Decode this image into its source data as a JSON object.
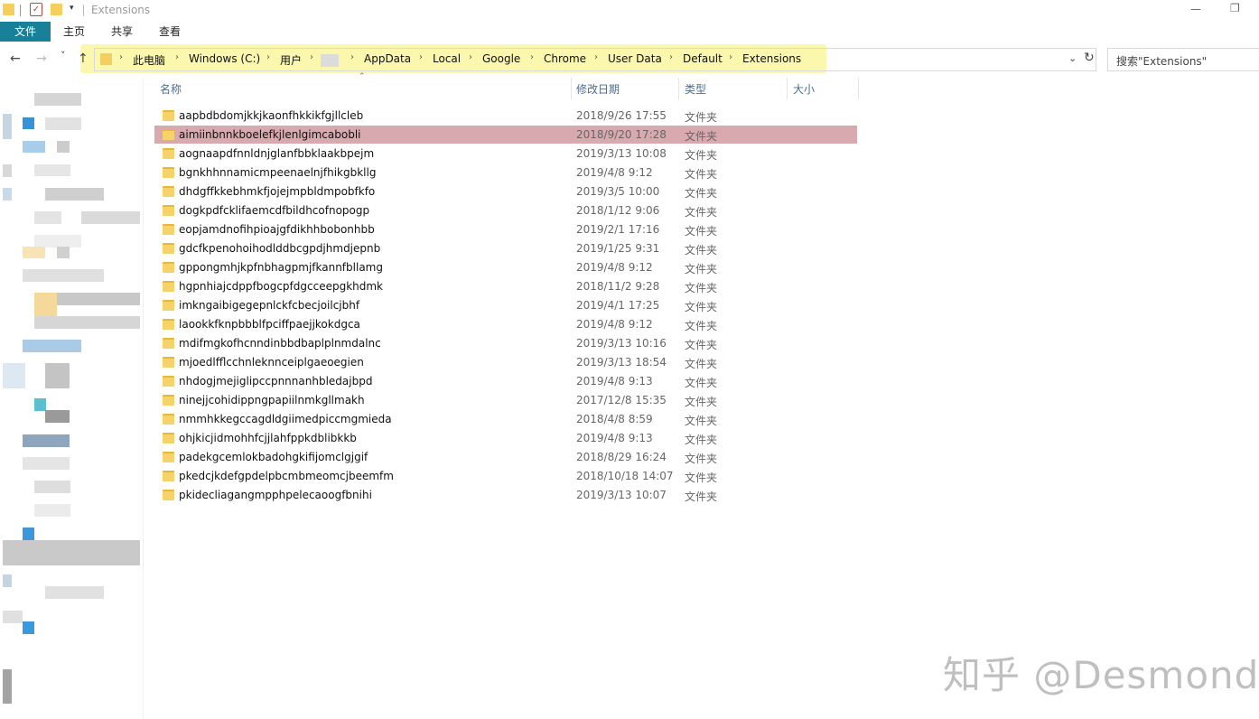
{
  "window": {
    "title": "Extensions",
    "minimize_glyph": "—",
    "restore_glyph": "❐"
  },
  "quick_access": {
    "dropdown_glyph": "▾",
    "check_glyph": "✓"
  },
  "ribbon": {
    "file_tab": "文件",
    "tabs": [
      "主页",
      "共享",
      "查看"
    ]
  },
  "navigation": {
    "back_glyph": "←",
    "forward_glyph": "→",
    "recent_glyph": "˅",
    "up_glyph": "↑",
    "arrow_glyph": "›",
    "breadcrumbs": [
      "此电脑",
      "Windows (C:)",
      "用户",
      "AppData",
      "Local",
      "Google",
      "Chrome",
      "User Data",
      "Default",
      "Extensions"
    ],
    "address_dropdown_glyph": "⌄",
    "refresh_glyph": "↻",
    "search_placeholder": "搜索\"Extensions\""
  },
  "columns": {
    "name": "名称",
    "modified": "修改日期",
    "type": "类型",
    "size": "大小",
    "sort_glyph": "⌃"
  },
  "files": [
    {
      "name": "aapbdbdomjkkjkaonfhkkikfgjllcleb",
      "modified": "2018/9/26 17:55",
      "type": "文件夹"
    },
    {
      "name": "aimiinbnnkboelefkjlenlgimcabobli",
      "modified": "2018/9/20 17:28",
      "type": "文件夹",
      "selected": true
    },
    {
      "name": "aognaapdfnnldnjglanfbbklaakbpejm",
      "modified": "2019/3/13 10:08",
      "type": "文件夹"
    },
    {
      "name": "bgnkhhnnamicmpeenaelnjfhikgbkllg",
      "modified": "2019/4/8 9:12",
      "type": "文件夹"
    },
    {
      "name": "dhdgffkkebhmkfjojejmpbldmpobfkfo",
      "modified": "2019/3/5 10:00",
      "type": "文件夹"
    },
    {
      "name": "dogkpdfcklifaemcdfbildhcofnopogp",
      "modified": "2018/1/12 9:06",
      "type": "文件夹"
    },
    {
      "name": "eopjamdnofihpioajgfdikhhbobonhbb",
      "modified": "2019/2/1 17:16",
      "type": "文件夹"
    },
    {
      "name": "gdcfkpenohoihodlddbcgpdjhmdjepnb",
      "modified": "2019/1/25 9:31",
      "type": "文件夹"
    },
    {
      "name": "gppongmhjkpfnbhagpmjfkannfbllamg",
      "modified": "2019/4/8 9:12",
      "type": "文件夹"
    },
    {
      "name": "hgpnhiajcdppfbogcpfdgcceepgkhdmk",
      "modified": "2018/11/2 9:28",
      "type": "文件夹"
    },
    {
      "name": "imkngaibigegepnlckfcbecjoilcjbhf",
      "modified": "2019/4/1 17:25",
      "type": "文件夹"
    },
    {
      "name": "laookkfknpbbblfpciffpaejjkokdgca",
      "modified": "2019/4/8 9:12",
      "type": "文件夹"
    },
    {
      "name": "mdifmgkofhcnndinbbdbaplplnmdalnc",
      "modified": "2019/3/13 10:16",
      "type": "文件夹"
    },
    {
      "name": "mjoedlfflcchnleknnceiplgaeoegien",
      "modified": "2019/3/13 18:54",
      "type": "文件夹"
    },
    {
      "name": "nhdogjmejiglipccpnnnanhbledajbpd",
      "modified": "2019/4/8 9:13",
      "type": "文件夹"
    },
    {
      "name": "ninejjcohidippngpapiilnmkgllmakh",
      "modified": "2017/12/8 15:35",
      "type": "文件夹"
    },
    {
      "name": "nmmhkkegccagdldgiimedpiccmgmieda",
      "modified": "2018/4/8 8:59",
      "type": "文件夹"
    },
    {
      "name": "ohjkicjidmohhfcjjlahfppkdblibkkb",
      "modified": "2019/4/8 9:13",
      "type": "文件夹"
    },
    {
      "name": "padekgcemlokbadohgkifijomclgjgif",
      "modified": "2018/8/29 16:24",
      "type": "文件夹"
    },
    {
      "name": "pkedcjkdefgpdelpbcmbmeomcjbeemfm",
      "modified": "2018/10/18 14:07",
      "type": "文件夹"
    },
    {
      "name": "pkidecliagangmpphpelecaoogfbnihi",
      "modified": "2019/3/13 10:07",
      "type": "文件夹"
    }
  ],
  "watermark": "知乎 @Desmond",
  "colors": {
    "file_tab": "#19809a",
    "address_highlight": "#fbf7ad",
    "selected_row": "#d8a9ae",
    "folder": "#f6d26a",
    "column_header_text": "#4d6d8e"
  }
}
